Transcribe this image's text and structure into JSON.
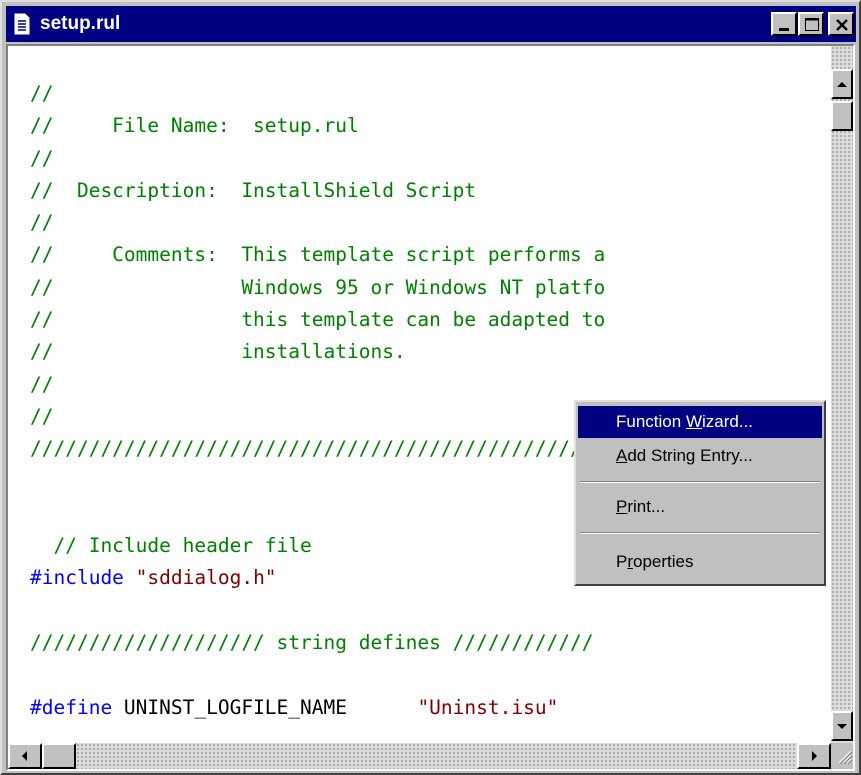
{
  "window": {
    "title": "setup.rul",
    "title_icon": "document-icon"
  },
  "titlebar_buttons": {
    "minimize": "minimize-icon",
    "maximize": "maximize-icon",
    "close": "close-icon"
  },
  "code_lines": [
    [
      {
        "t": "//",
        "c": "comment"
      }
    ],
    [
      {
        "t": "//     File Name:  setup.rul",
        "c": "comment"
      }
    ],
    [
      {
        "t": "//",
        "c": "comment"
      }
    ],
    [
      {
        "t": "//  Description:  InstallShield Script",
        "c": "comment"
      }
    ],
    [
      {
        "t": "//",
        "c": "comment"
      }
    ],
    [
      {
        "t": "//     Comments:  This template script performs a",
        "c": "comment"
      }
    ],
    [
      {
        "t": "//                Windows 95 or Windows NT platfo",
        "c": "comment"
      }
    ],
    [
      {
        "t": "//                this template can be adapted to",
        "c": "comment"
      }
    ],
    [
      {
        "t": "//                installations.",
        "c": "comment"
      }
    ],
    [
      {
        "t": "//",
        "c": "comment"
      }
    ],
    [
      {
        "t": "//",
        "c": "comment"
      }
    ],
    [
      {
        "t": "//////////////////////////////////////////////////////////////////",
        "c": "comment"
      }
    ],
    [
      {
        "t": "",
        "c": "comment"
      }
    ],
    [
      {
        "t": "",
        "c": "comment"
      }
    ],
    [
      {
        "t": "  // Include header file",
        "c": "comment"
      }
    ],
    [
      {
        "t": "#include",
        "c": "keyword"
      },
      {
        "t": " ",
        "c": "plain"
      },
      {
        "t": "\"sddialog.h\"",
        "c": "string"
      }
    ],
    [
      {
        "t": "",
        "c": "comment"
      }
    ],
    [
      {
        "t": "//////////////////// string defines ////////////",
        "c": "comment"
      }
    ],
    [
      {
        "t": "",
        "c": "comment"
      }
    ],
    [
      {
        "t": "#define",
        "c": "keyword"
      },
      {
        "t": " UNINST_LOGFILE_NAME      ",
        "c": "plain"
      },
      {
        "t": "\"Uninst.isu\"",
        "c": "string"
      }
    ]
  ],
  "context_menu": {
    "items": [
      {
        "pre": "Function ",
        "acc": "W",
        "post": "izard...",
        "selected": true
      },
      {
        "pre": "",
        "acc": "A",
        "post": "dd String Entry...",
        "selected": false
      },
      {
        "pre": "",
        "acc": "P",
        "post": "rint...",
        "selected": false
      },
      {
        "pre": "P",
        "acc": "r",
        "post": "operties",
        "selected": false
      }
    ]
  },
  "colors": {
    "comment": "#008000",
    "keyword": "#0000ff",
    "string": "#800000",
    "titlebar": "#000080",
    "menu_highlight": "#000080"
  }
}
